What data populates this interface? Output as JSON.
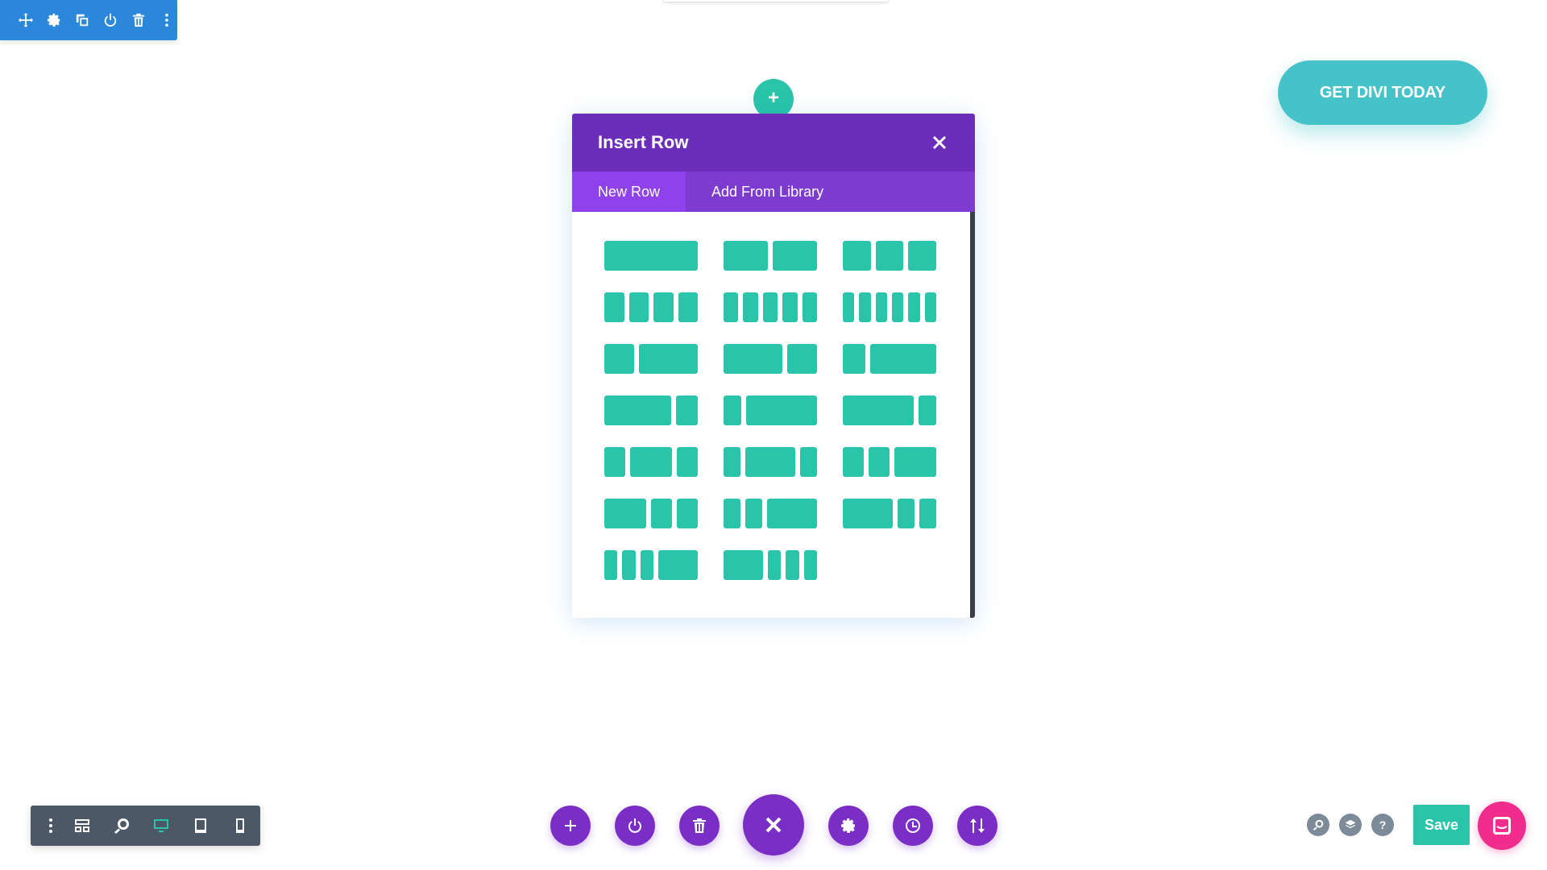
{
  "section_toolbar": {
    "icons": [
      "move-icon",
      "gear-icon",
      "duplicate-icon",
      "power-icon",
      "trash-icon",
      "more-icon"
    ]
  },
  "cta": {
    "label": "GET DIVI TODAY"
  },
  "add_row": {
    "label": "+"
  },
  "modal": {
    "title": "Insert Row",
    "tabs": [
      {
        "label": "New Row",
        "active": true
      },
      {
        "label": "Add From Library",
        "active": false
      }
    ],
    "layouts": [
      [
        1
      ],
      [
        1,
        1
      ],
      [
        1,
        1,
        1
      ],
      [
        1,
        1,
        1,
        1
      ],
      [
        1,
        1,
        1,
        1,
        1
      ],
      [
        1,
        1,
        1,
        1,
        1,
        1
      ],
      [
        1,
        2
      ],
      [
        2,
        1
      ],
      [
        1,
        3
      ],
      [
        3,
        1
      ],
      [
        1,
        4
      ],
      [
        4,
        1
      ],
      [
        1,
        2,
        1
      ],
      [
        1,
        3,
        1
      ],
      [
        1,
        1,
        2
      ],
      [
        2,
        1,
        1
      ],
      [
        1,
        1,
        3
      ],
      [
        3,
        1,
        1
      ],
      [
        1,
        1,
        1,
        3
      ],
      [
        3,
        1,
        1,
        1
      ]
    ],
    "accent_color": "#29c4a9"
  },
  "view_toolbar": {
    "buttons": [
      "more-icon",
      "wireframe-icon",
      "zoom-icon",
      "desktop-icon",
      "tablet-icon",
      "phone-icon"
    ],
    "active": "desktop-icon"
  },
  "bottom_center": {
    "buttons": [
      "add-icon",
      "power-icon",
      "trash-icon",
      "close-icon",
      "gear-icon",
      "history-icon",
      "sort-icon"
    ]
  },
  "bottom_right": {
    "icons": [
      "search-icon",
      "layers-icon",
      "help-icon"
    ],
    "help_label": "?",
    "save_label": "Save"
  },
  "colors": {
    "primary_purple": "#7b2ec5",
    "header_purple": "#6c2eb9",
    "teal": "#29c4a9",
    "blue": "#2b87da",
    "cta": "#45c3c9",
    "pink": "#f02c8c"
  }
}
